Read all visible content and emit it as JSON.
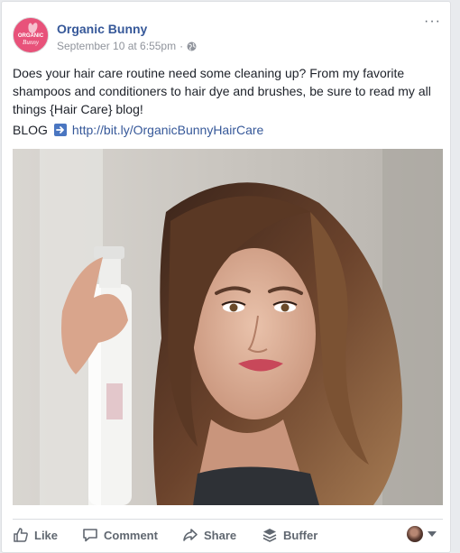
{
  "post": {
    "page_name": "Organic Bunny",
    "avatar_text": [
      "ORGANIC",
      "Bunny"
    ],
    "timestamp": "September 10 at 6:55pm",
    "separator": "·",
    "privacy_icon": "globe-icon",
    "more_icon": "ellipsis-icon",
    "more_label": "···",
    "text": "Does your hair care routine need some cleaning up? From my favorite shampoos and conditioners to hair dye and brushes, be sure to read my all things {Hair Care} blog!",
    "blog_label": "BLOG",
    "arrow_icon": "right-arrow-icon",
    "link_text": "http://bit.ly/OrganicBunnyHairCare"
  },
  "actions": {
    "like_label": "Like",
    "comment_label": "Comment",
    "share_label": "Share",
    "buffer_label": "Buffer"
  },
  "colors": {
    "accent": "#365899",
    "brand_pink": "#e8527a",
    "text": "#1d2129",
    "muted": "#90949c",
    "action": "#606770"
  }
}
